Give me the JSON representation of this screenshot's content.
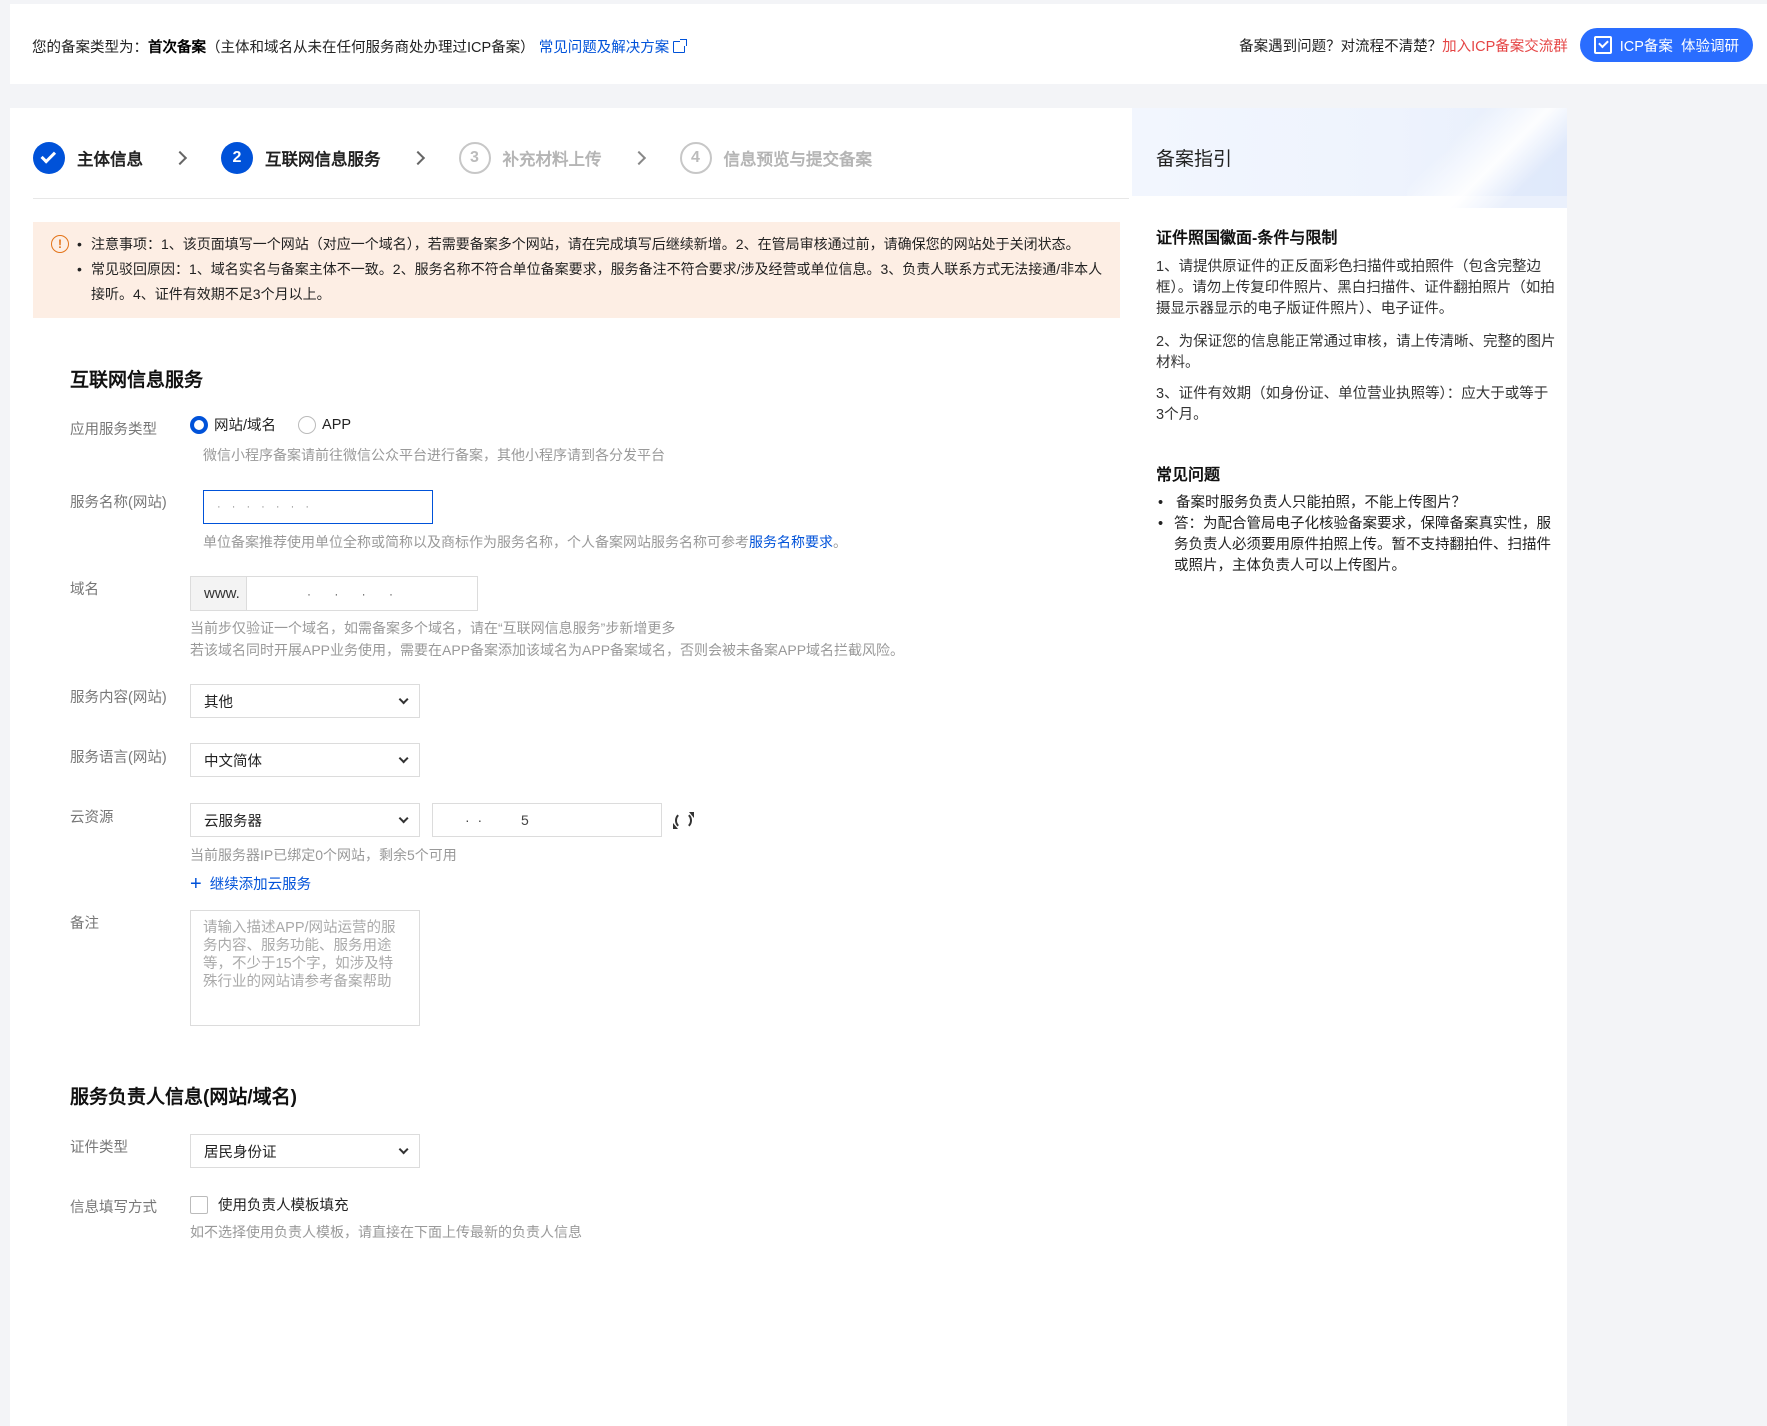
{
  "topbar": {
    "type_prefix": "您的备案类型为：",
    "type_value": "首次备案",
    "type_desc": "（主体和域名从未在任何服务商处办理过ICP备案）",
    "faq_link": "常见问题及解决方案",
    "question": "备案遇到问题？对流程不清楚？",
    "join_link": "加入ICP备案交流群",
    "survey_btn": "ICP备案  体验调研"
  },
  "steps": [
    {
      "num": "",
      "label": "主体信息",
      "state": "done"
    },
    {
      "num": "2",
      "label": "互联网信息服务",
      "state": "active"
    },
    {
      "num": "3",
      "label": "补充材料上传",
      "state": "todo"
    },
    {
      "num": "4",
      "label": "信息预览与提交备案",
      "state": "todo"
    }
  ],
  "notice": {
    "item1": "注意事项：1、该页面填写一个网站（对应一个域名），若需要备案多个网站，请在完成填写后继续新增。2、在管局审核通过前，请确保您的网站处于关闭状态。",
    "item2": "常见驳回原因：1、域名实名与备案主体不一致。2、服务名称不符合单位备案要求，服务备注不符合要求/涉及经营或单位信息。3、负责人联系方式无法接通/非本人接听。4、证件有效期不足3个月以上。"
  },
  "form": {
    "section_title": "互联网信息服务",
    "service_type_label": "应用服务类型",
    "service_type_opt1": "网站/域名",
    "service_type_opt2": "APP",
    "service_type_help": "微信小程序备案请前往微信公众平台进行备案，其他小程序请到各分发平台",
    "service_name_label": "服务名称(网站)",
    "service_name_value": "·  ·  ·  ·  ·  ·  ·",
    "service_name_help": "单位备案推荐使用单位全称或简称以及商标作为服务名称，个人备案网站服务名称可参考",
    "service_name_link": "服务名称要求",
    "service_name_help_end": "。",
    "domain_label": "域名",
    "domain_prefix": "www.",
    "domain_value": "·  ·  ·  ·",
    "domain_help1": "当前步仅验证一个域名，如需备案多个域名，请在“互联网信息服务”步新增更多",
    "domain_help2": "若该域名同时开展APP业务使用，需要在APP备案添加该域名为APP备案域名，否则会被未备案APP域名拦截风险。",
    "content_label": "服务内容(网站)",
    "content_value": "其他",
    "language_label": "服务语言(网站)",
    "language_value": "中文简体",
    "cloud_label": "云资源",
    "cloud_type_value": "云服务器",
    "cloud_ip_value": "·  ·          5",
    "cloud_help": "当前服务器IP已绑定0个网站，剩余5个可用",
    "add_cloud": "继续添加云服务",
    "remark_label": "备注",
    "remark_placeholder": "请输入描述APP/网站运营的服务内容、服务功能、服务用途等，不少于15个字，如涉及特殊行业的网站请参考备案帮助",
    "owner_section_title": "服务负责人信息(网站/域名)",
    "id_type_label": "证件类型",
    "id_type_value": "居民身份证",
    "fill_method_label": "信息填写方式",
    "fill_method_checkbox": "使用负责人模板填充",
    "fill_method_help": "如不选择使用负责人模板，请直接在下面上传最新的负责人信息"
  },
  "guide": {
    "title": "备案指引",
    "sub1": "证件照国徽面-条件与限制",
    "p1": "1、请提供原证件的正反面彩色扫描件或拍照件（包含完整边框）。请勿上传复印件照片、黑白扫描件、证件翻拍照片（如拍摄显示器显示的电子版证件照片）、电子证件。",
    "p2": "2、为保证您的信息能正常通过审核，请上传清晰、完整的图片材料。",
    "p3": "3、证件有效期（如身份证、单位营业执照等）：应大于或等于3个月。",
    "sub2": "常见问题",
    "faq_q": "备案时服务负责人只能拍照，不能上传图片？",
    "faq_a": "答：为配合管局电子化核验备案要求，保障备案真实性，服务负责人必须要用原件拍照上传。暂不支持翻拍件、扫描件或照片，主体负责人可以上传图片。"
  },
  "colors": {
    "primary": "#0052d9",
    "warn": "#e37318",
    "notice_bg": "#fdeee4",
    "join": "#e54545"
  }
}
